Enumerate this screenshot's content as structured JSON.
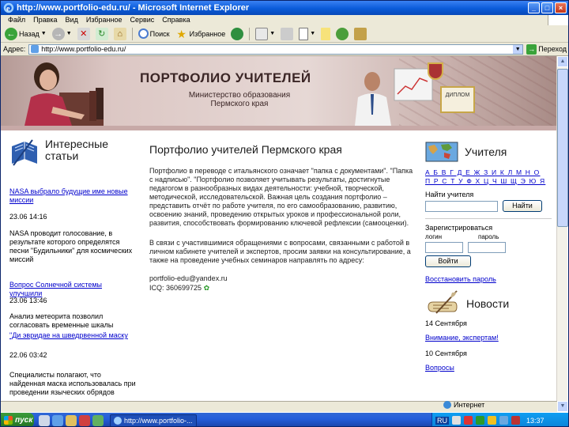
{
  "window": {
    "title": "http://www.portfolio-edu.ru/ - Microsoft Internet Explorer",
    "colors": {
      "titlebar": "#0a5bd9",
      "chrome": "#ece9d8",
      "banner": "#c7a9a7",
      "link": "#0000cc"
    }
  },
  "menu": [
    "Файл",
    "Правка",
    "Вид",
    "Избранное",
    "Сервис",
    "Справка"
  ],
  "toolbar": {
    "back_label": "Назад",
    "search_label": "Поиск",
    "favorites_label": "Избранное"
  },
  "address": {
    "label": "Адрес:",
    "url": "http://www.portfolio-edu.ru/",
    "go_label": "Переход"
  },
  "banner": {
    "title": "ПОРТФОЛИО УЧИТЕЛЕЙ",
    "subtitle_line1": "Министерство образования",
    "subtitle_line2": "Пермского края",
    "diploma_text": "ДИПЛОМ"
  },
  "left": {
    "heading_line1": "Интересные",
    "heading_line2": "статьи",
    "items": [
      {
        "link": "NASA выбрало будущие име новые миссии",
        "date": "23.06 14:16",
        "text": "NASA проводит голосование, в результате которого определятся песни \"Будильники\" для космических миссий"
      },
      {
        "link": "Вопрос Солнечной системы улучшили",
        "date": "23.06 13:46",
        "text": "Анализ метеорита позволил согласовать временные шкалы"
      },
      {
        "link": "\"Ди эвридае на шведрвенной маску",
        "date": "22.06 03:42",
        "text": "Специалисты полагают, что найденная маска использовалась при проведении языческих обрядов"
      }
    ]
  },
  "center": {
    "title": "Портфолио учителей Пермского края",
    "p1": "Портфолио в переводе с итальянского означает \"папка с документами\". \"Папка с надписью\". \"Портфолио позволяет учитывать результаты, достигнутые педагогом в разнообразных видах деятельности: учебной, творческой, методической, исследовательской. Важная цель создания портфолио – представить отчёт по работе учителя, по его самообразованию, развитию, освоению знаний, проведению открытых уроков и профессиональной роли, развития, способствовать формированию ключевой рефлексии (самооценки).",
    "p2": "В связи с участившимися обращениями с вопросами, связанными с работой в личном кабинете учителей и экспертов, просим заявки на консультирование, а также на проведение учебных семинаров направлять по адресу:",
    "email": "portfolio-edu@yandex.ru",
    "icq": "ICQ: 360699725"
  },
  "right": {
    "teachers_heading": "Учителя",
    "alphabet_row1": "А Б В Г Д Е Ж З И К Л М Н О",
    "alphabet_row2": "П Р С Т У Ф Х Ц Ч Ш Щ Э Ю Я",
    "find_label": "Найти учителя",
    "find_button": "Найти",
    "register_label": "Зарегистрироваться",
    "login_label": "логин",
    "password_label": "пароль",
    "enter_button": "Войти",
    "forgot_link": "Восстановить пароль",
    "news_heading": "Новости",
    "news": [
      {
        "date": "14 Сентября",
        "link": "Внимание, экспертам!"
      },
      {
        "date": "10 Сентября",
        "link": "Вопросы"
      }
    ]
  },
  "status": {
    "zone": "Интернет"
  },
  "taskbar": {
    "start": "пуск",
    "task": "http://www.portfolio-...",
    "lang": "RU",
    "clock": "13:37"
  }
}
